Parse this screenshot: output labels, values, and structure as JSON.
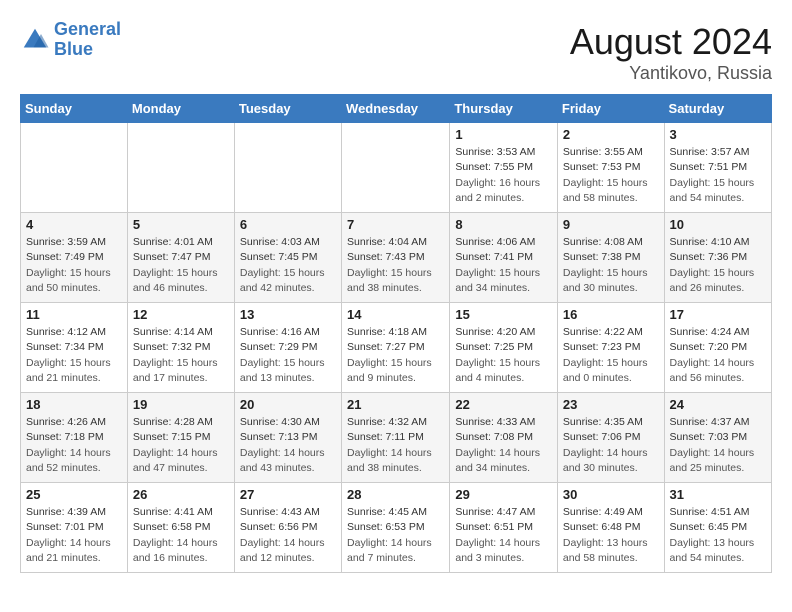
{
  "header": {
    "logo_line1": "General",
    "logo_line2": "Blue",
    "main_title": "August 2024",
    "sub_title": "Yantikovo, Russia"
  },
  "days_of_week": [
    "Sunday",
    "Monday",
    "Tuesday",
    "Wednesday",
    "Thursday",
    "Friday",
    "Saturday"
  ],
  "weeks": [
    [
      {
        "day": "",
        "sunrise": "",
        "sunset": "",
        "daylight": ""
      },
      {
        "day": "",
        "sunrise": "",
        "sunset": "",
        "daylight": ""
      },
      {
        "day": "",
        "sunrise": "",
        "sunset": "",
        "daylight": ""
      },
      {
        "day": "",
        "sunrise": "",
        "sunset": "",
        "daylight": ""
      },
      {
        "day": "1",
        "sunrise": "Sunrise: 3:53 AM",
        "sunset": "Sunset: 7:55 PM",
        "daylight": "Daylight: 16 hours and 2 minutes."
      },
      {
        "day": "2",
        "sunrise": "Sunrise: 3:55 AM",
        "sunset": "Sunset: 7:53 PM",
        "daylight": "Daylight: 15 hours and 58 minutes."
      },
      {
        "day": "3",
        "sunrise": "Sunrise: 3:57 AM",
        "sunset": "Sunset: 7:51 PM",
        "daylight": "Daylight: 15 hours and 54 minutes."
      }
    ],
    [
      {
        "day": "4",
        "sunrise": "Sunrise: 3:59 AM",
        "sunset": "Sunset: 7:49 PM",
        "daylight": "Daylight: 15 hours and 50 minutes."
      },
      {
        "day": "5",
        "sunrise": "Sunrise: 4:01 AM",
        "sunset": "Sunset: 7:47 PM",
        "daylight": "Daylight: 15 hours and 46 minutes."
      },
      {
        "day": "6",
        "sunrise": "Sunrise: 4:03 AM",
        "sunset": "Sunset: 7:45 PM",
        "daylight": "Daylight: 15 hours and 42 minutes."
      },
      {
        "day": "7",
        "sunrise": "Sunrise: 4:04 AM",
        "sunset": "Sunset: 7:43 PM",
        "daylight": "Daylight: 15 hours and 38 minutes."
      },
      {
        "day": "8",
        "sunrise": "Sunrise: 4:06 AM",
        "sunset": "Sunset: 7:41 PM",
        "daylight": "Daylight: 15 hours and 34 minutes."
      },
      {
        "day": "9",
        "sunrise": "Sunrise: 4:08 AM",
        "sunset": "Sunset: 7:38 PM",
        "daylight": "Daylight: 15 hours and 30 minutes."
      },
      {
        "day": "10",
        "sunrise": "Sunrise: 4:10 AM",
        "sunset": "Sunset: 7:36 PM",
        "daylight": "Daylight: 15 hours and 26 minutes."
      }
    ],
    [
      {
        "day": "11",
        "sunrise": "Sunrise: 4:12 AM",
        "sunset": "Sunset: 7:34 PM",
        "daylight": "Daylight: 15 hours and 21 minutes."
      },
      {
        "day": "12",
        "sunrise": "Sunrise: 4:14 AM",
        "sunset": "Sunset: 7:32 PM",
        "daylight": "Daylight: 15 hours and 17 minutes."
      },
      {
        "day": "13",
        "sunrise": "Sunrise: 4:16 AM",
        "sunset": "Sunset: 7:29 PM",
        "daylight": "Daylight: 15 hours and 13 minutes."
      },
      {
        "day": "14",
        "sunrise": "Sunrise: 4:18 AM",
        "sunset": "Sunset: 7:27 PM",
        "daylight": "Daylight: 15 hours and 9 minutes."
      },
      {
        "day": "15",
        "sunrise": "Sunrise: 4:20 AM",
        "sunset": "Sunset: 7:25 PM",
        "daylight": "Daylight: 15 hours and 4 minutes."
      },
      {
        "day": "16",
        "sunrise": "Sunrise: 4:22 AM",
        "sunset": "Sunset: 7:23 PM",
        "daylight": "Daylight: 15 hours and 0 minutes."
      },
      {
        "day": "17",
        "sunrise": "Sunrise: 4:24 AM",
        "sunset": "Sunset: 7:20 PM",
        "daylight": "Daylight: 14 hours and 56 minutes."
      }
    ],
    [
      {
        "day": "18",
        "sunrise": "Sunrise: 4:26 AM",
        "sunset": "Sunset: 7:18 PM",
        "daylight": "Daylight: 14 hours and 52 minutes."
      },
      {
        "day": "19",
        "sunrise": "Sunrise: 4:28 AM",
        "sunset": "Sunset: 7:15 PM",
        "daylight": "Daylight: 14 hours and 47 minutes."
      },
      {
        "day": "20",
        "sunrise": "Sunrise: 4:30 AM",
        "sunset": "Sunset: 7:13 PM",
        "daylight": "Daylight: 14 hours and 43 minutes."
      },
      {
        "day": "21",
        "sunrise": "Sunrise: 4:32 AM",
        "sunset": "Sunset: 7:11 PM",
        "daylight": "Daylight: 14 hours and 38 minutes."
      },
      {
        "day": "22",
        "sunrise": "Sunrise: 4:33 AM",
        "sunset": "Sunset: 7:08 PM",
        "daylight": "Daylight: 14 hours and 34 minutes."
      },
      {
        "day": "23",
        "sunrise": "Sunrise: 4:35 AM",
        "sunset": "Sunset: 7:06 PM",
        "daylight": "Daylight: 14 hours and 30 minutes."
      },
      {
        "day": "24",
        "sunrise": "Sunrise: 4:37 AM",
        "sunset": "Sunset: 7:03 PM",
        "daylight": "Daylight: 14 hours and 25 minutes."
      }
    ],
    [
      {
        "day": "25",
        "sunrise": "Sunrise: 4:39 AM",
        "sunset": "Sunset: 7:01 PM",
        "daylight": "Daylight: 14 hours and 21 minutes."
      },
      {
        "day": "26",
        "sunrise": "Sunrise: 4:41 AM",
        "sunset": "Sunset: 6:58 PM",
        "daylight": "Daylight: 14 hours and 16 minutes."
      },
      {
        "day": "27",
        "sunrise": "Sunrise: 4:43 AM",
        "sunset": "Sunset: 6:56 PM",
        "daylight": "Daylight: 14 hours and 12 minutes."
      },
      {
        "day": "28",
        "sunrise": "Sunrise: 4:45 AM",
        "sunset": "Sunset: 6:53 PM",
        "daylight": "Daylight: 14 hours and 7 minutes."
      },
      {
        "day": "29",
        "sunrise": "Sunrise: 4:47 AM",
        "sunset": "Sunset: 6:51 PM",
        "daylight": "Daylight: 14 hours and 3 minutes."
      },
      {
        "day": "30",
        "sunrise": "Sunrise: 4:49 AM",
        "sunset": "Sunset: 6:48 PM",
        "daylight": "Daylight: 13 hours and 58 minutes."
      },
      {
        "day": "31",
        "sunrise": "Sunrise: 4:51 AM",
        "sunset": "Sunset: 6:45 PM",
        "daylight": "Daylight: 13 hours and 54 minutes."
      }
    ]
  ]
}
